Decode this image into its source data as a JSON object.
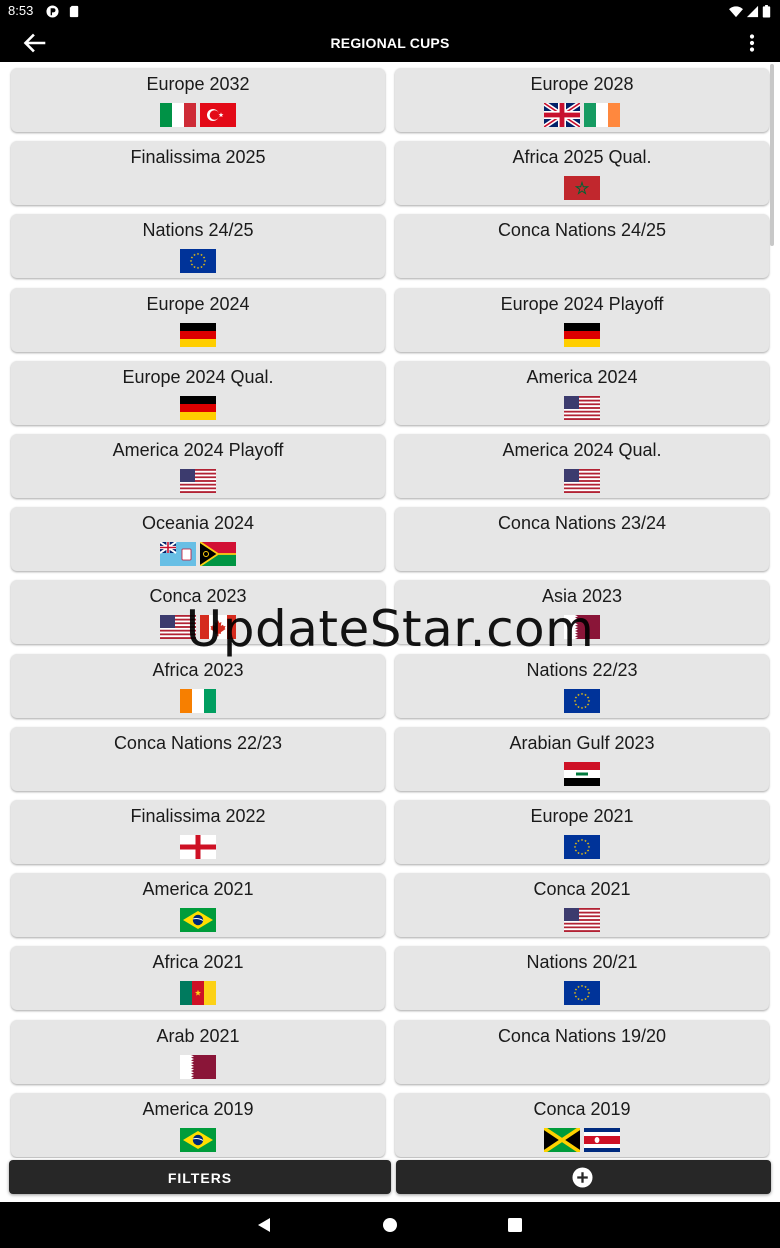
{
  "status": {
    "time": "8:53"
  },
  "appbar": {
    "title": "REGIONAL CUPS"
  },
  "watermark": "UpdateStar.com",
  "cups": [
    {
      "name": "Europe 2032",
      "flags": [
        "italy",
        "turkey"
      ]
    },
    {
      "name": "Europe 2028",
      "flags": [
        "uk",
        "ireland"
      ]
    },
    {
      "name": "Finalissima 2025",
      "flags": []
    },
    {
      "name": "Africa 2025 Qual.",
      "flags": [
        "morocco"
      ]
    },
    {
      "name": "Nations 24/25",
      "flags": [
        "eu"
      ]
    },
    {
      "name": "Conca Nations 24/25",
      "flags": []
    },
    {
      "name": "Europe 2024",
      "flags": [
        "germany"
      ]
    },
    {
      "name": "Europe 2024 Playoff",
      "flags": [
        "germany"
      ]
    },
    {
      "name": "Europe 2024 Qual.",
      "flags": [
        "germany"
      ]
    },
    {
      "name": "America 2024",
      "flags": [
        "usa"
      ]
    },
    {
      "name": "America 2024 Playoff",
      "flags": [
        "usa"
      ]
    },
    {
      "name": "America 2024 Qual.",
      "flags": [
        "usa"
      ]
    },
    {
      "name": "Oceania 2024",
      "flags": [
        "fiji",
        "vanuatu"
      ]
    },
    {
      "name": "Conca Nations 23/24",
      "flags": []
    },
    {
      "name": "Conca 2023",
      "flags": [
        "usa",
        "canada"
      ]
    },
    {
      "name": "Asia 2023",
      "flags": [
        "qatar"
      ]
    },
    {
      "name": "Africa 2023",
      "flags": [
        "ivory-coast"
      ]
    },
    {
      "name": "Nations 22/23",
      "flags": [
        "eu"
      ]
    },
    {
      "name": "Conca Nations 22/23",
      "flags": []
    },
    {
      "name": "Arabian Gulf 2023",
      "flags": [
        "iraq"
      ]
    },
    {
      "name": "Finalissima 2022",
      "flags": [
        "england"
      ]
    },
    {
      "name": "Europe 2021",
      "flags": [
        "eu"
      ]
    },
    {
      "name": "America 2021",
      "flags": [
        "brazil"
      ]
    },
    {
      "name": "Conca 2021",
      "flags": [
        "usa"
      ]
    },
    {
      "name": "Africa 2021",
      "flags": [
        "cameroon"
      ]
    },
    {
      "name": "Nations 20/21",
      "flags": [
        "eu"
      ]
    },
    {
      "name": "Arab 2021",
      "flags": [
        "qatar"
      ]
    },
    {
      "name": "Conca Nations 19/20",
      "flags": []
    },
    {
      "name": "America 2019",
      "flags": [
        "brazil"
      ]
    },
    {
      "name": "Conca 2019",
      "flags": [
        "jamaica",
        "costa-rica"
      ]
    }
  ],
  "bottom": {
    "filters_label": "FILTERS",
    "add_icon": "add-circle-icon"
  }
}
